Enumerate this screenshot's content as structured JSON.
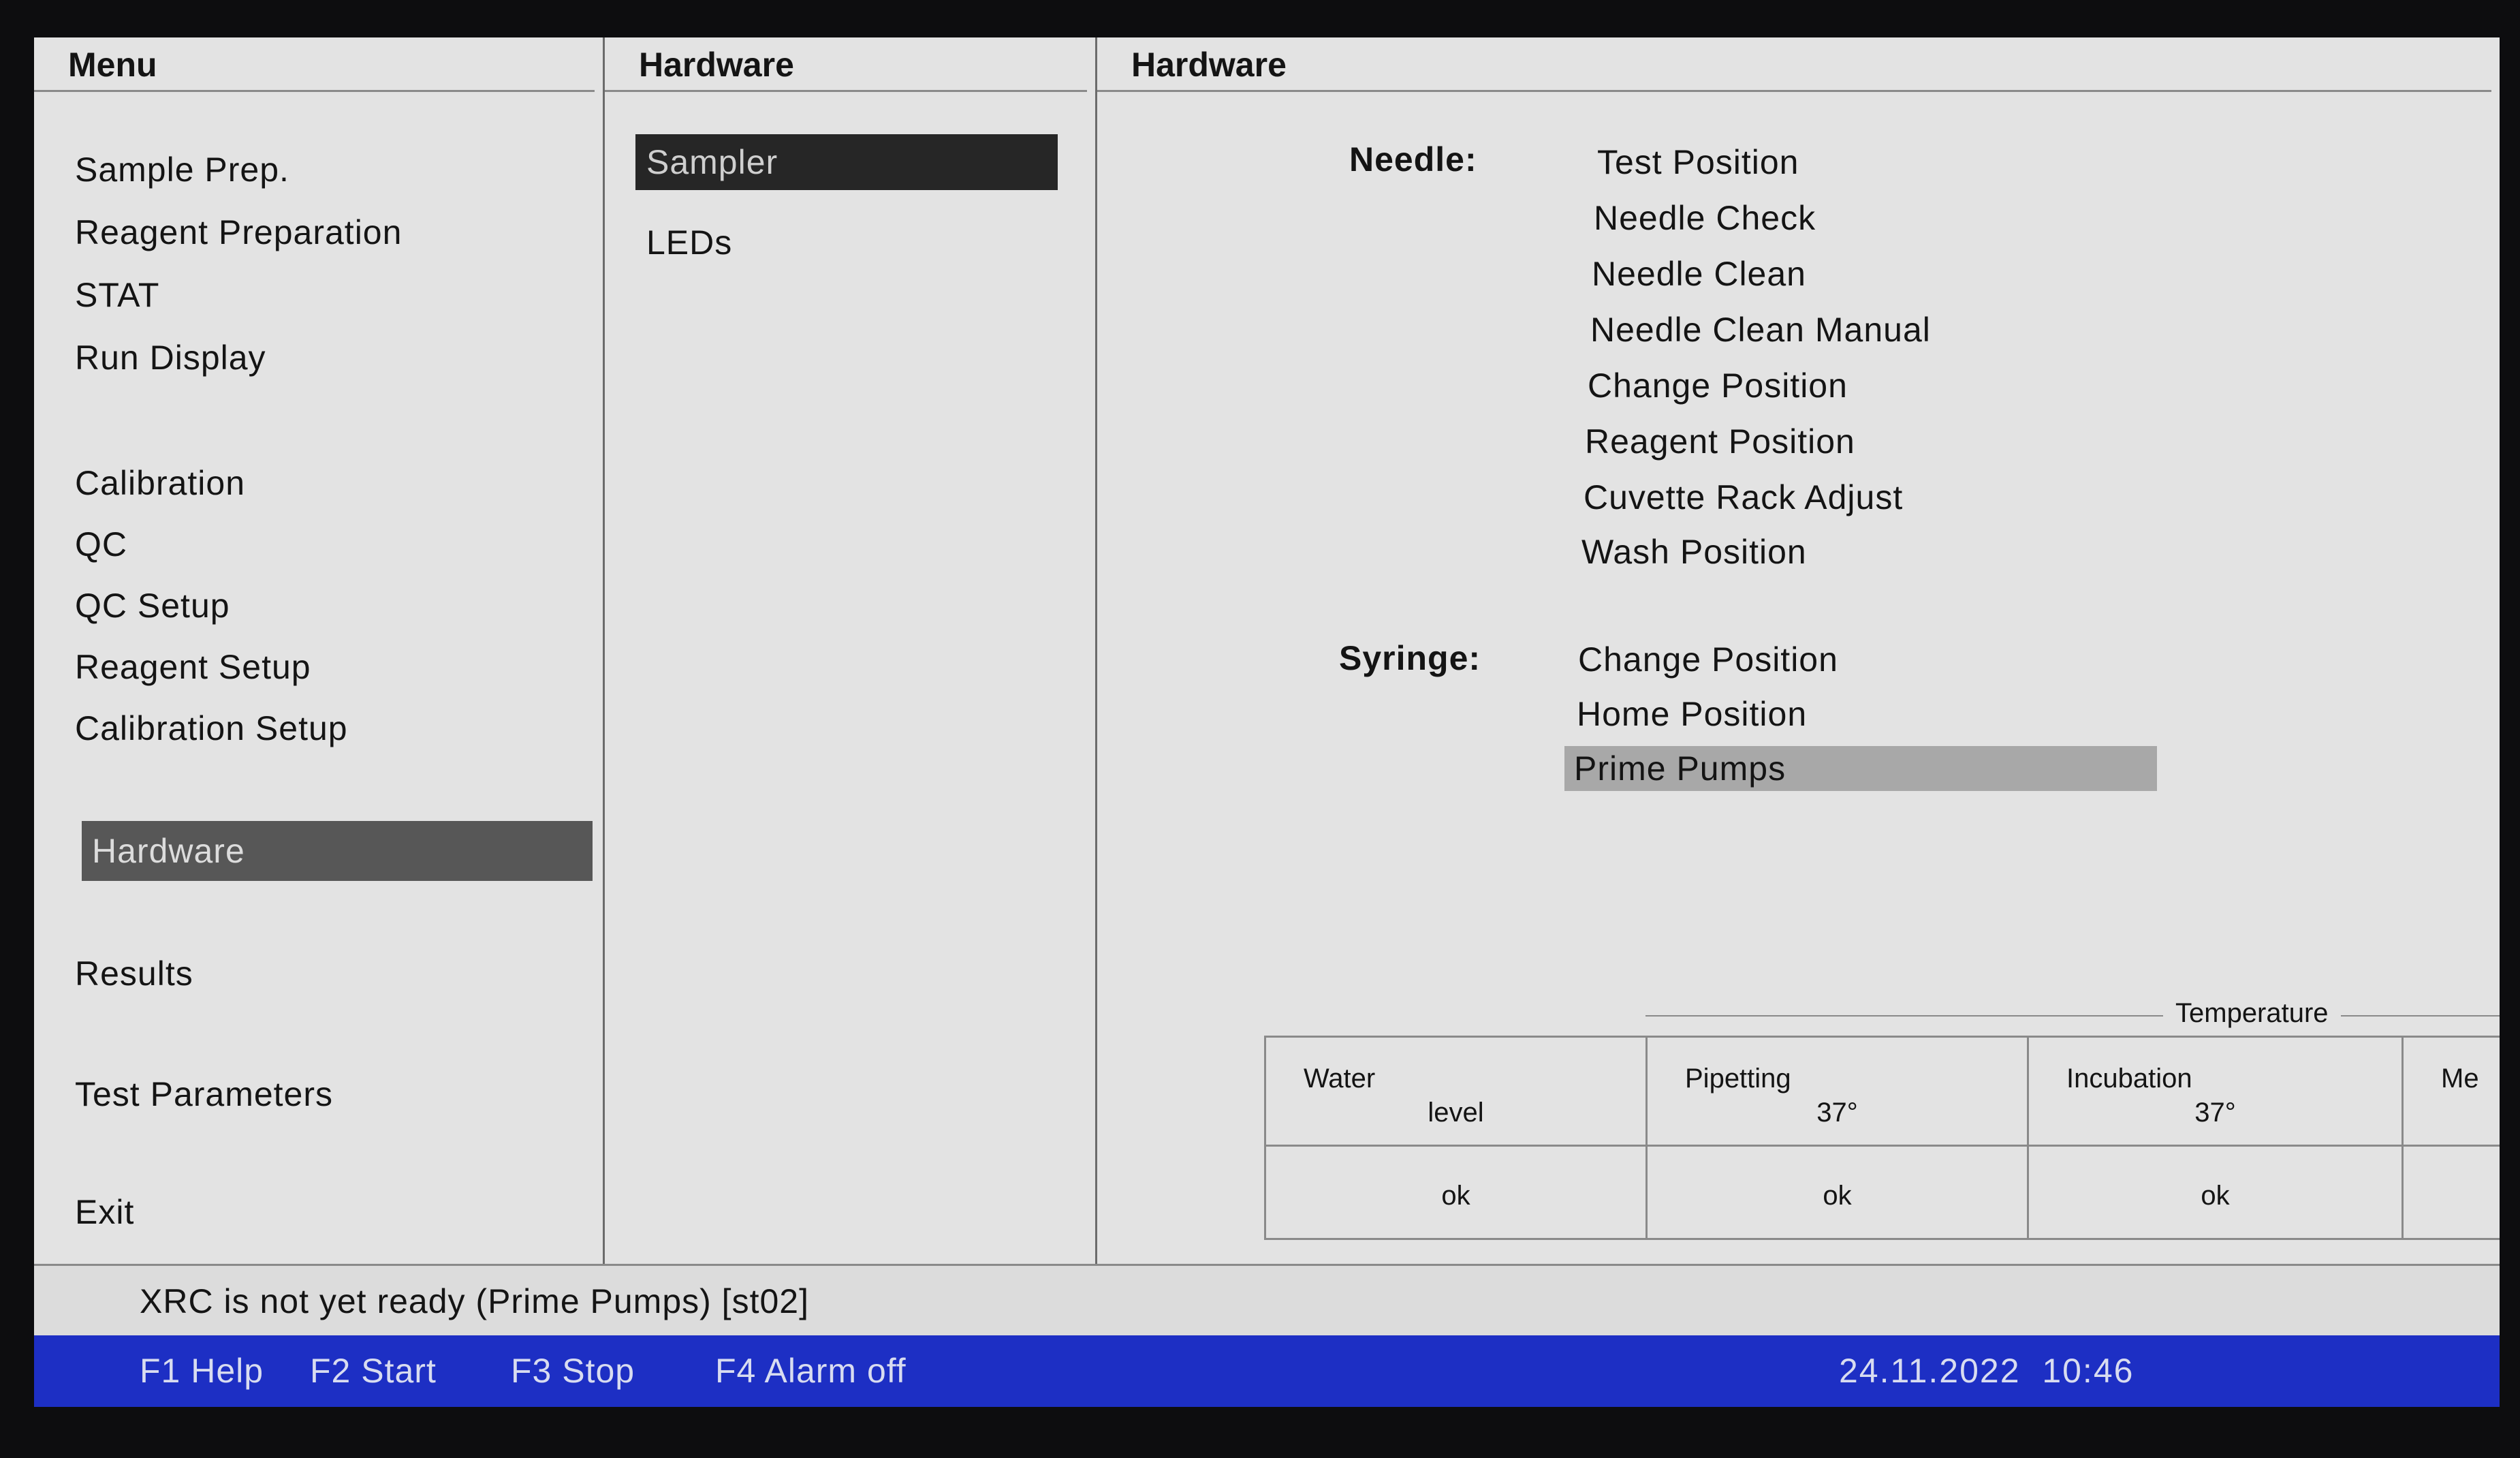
{
  "menu": {
    "header": "Menu",
    "items": [
      {
        "label": "Sample Prep."
      },
      {
        "label": "Reagent Preparation"
      },
      {
        "label": "STAT"
      },
      {
        "label": "Run Display"
      },
      {
        "label": "Calibration"
      },
      {
        "label": "QC"
      },
      {
        "label": "QC Setup"
      },
      {
        "label": "Reagent Setup"
      },
      {
        "label": "Calibration Setup"
      },
      {
        "label": "Hardware",
        "selected": true
      },
      {
        "label": "Results"
      },
      {
        "label": "Test Parameters"
      },
      {
        "label": "Exit"
      }
    ]
  },
  "submenu": {
    "header": "Hardware",
    "items": [
      {
        "label": "Sampler",
        "selected": true
      },
      {
        "label": "LEDs"
      }
    ]
  },
  "detail": {
    "header": "Hardware",
    "needle": {
      "label": "Needle:",
      "actions": [
        "Test Position",
        "Needle Check",
        "Needle Clean",
        "Needle Clean Manual",
        "Change Position",
        "Reagent Position",
        "Cuvette Rack Adjust",
        "Wash Position"
      ]
    },
    "syringe": {
      "label": "Syringe:",
      "actions": [
        {
          "label": "Change Position"
        },
        {
          "label": "Home Position"
        },
        {
          "label": "Prime Pumps",
          "selected": true
        }
      ]
    },
    "status_table": {
      "group_label": "Temperature",
      "columns": [
        {
          "name": "Water",
          "sub": "level",
          "value": "ok"
        },
        {
          "name": "Pipetting",
          "sub": "37°",
          "value": "ok"
        },
        {
          "name": "Incubation",
          "sub": "37°",
          "value": "ok"
        },
        {
          "name": "Me",
          "sub": "",
          "value": ""
        }
      ]
    }
  },
  "status_message": "XRC is not yet ready (Prime Pumps)  [st02]",
  "function_keys": [
    {
      "label": "F1 Help"
    },
    {
      "label": "F2 Start"
    },
    {
      "label": "F3 Stop"
    },
    {
      "label": "F4 Alarm off"
    }
  ],
  "clock": "24.11.2022  10:46",
  "colors": {
    "screen_bg": "#e3e3e3",
    "selected_menu_bg": "#575757",
    "selected_submenu_bg": "#262626",
    "selected_action_bg": "#a8a8a8",
    "function_bar_bg": "#1d2fc4"
  }
}
